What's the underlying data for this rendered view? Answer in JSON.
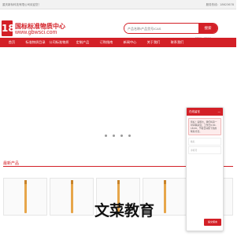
{
  "topbar": {
    "welcome": "重庆新标科技有限公司欢迎您！",
    "hotline": "服务热线：18623678"
  },
  "header": {
    "logo_text": "18",
    "brand_cn": "国标标准物质中心",
    "brand_url": "www.gbwsci.com",
    "search_placeholder": "产品名称/产品货号/CAS",
    "search_button": "搜索",
    "hot_searches": [
      "BPA标准品",
      "苯并[a]芘标准",
      "PFOA标准溶液",
      "重金属混标",
      "BTEX",
      "PFOS"
    ]
  },
  "nav": [
    "首页",
    "标准物质目录",
    "公司标准物质",
    "定制产品",
    "订购指南",
    "新闻中心",
    "关于我们",
    "联系我们"
  ],
  "banner": {
    "dots": 4
  },
  "section": {
    "title": "最新产品"
  },
  "products": [
    {},
    {},
    {},
    {},
    {}
  ],
  "watermark": "文菜教育",
  "chat": {
    "title": "在线留言",
    "min": "—",
    "message": "您好！请留言，我们将第一时间联系您；工作日9:00-18:00，节假日请留下您的联系方式。",
    "fields": [
      "姓名",
      "手机号"
    ],
    "button": "提交留言"
  },
  "colors": {
    "accent": "#d32027"
  }
}
